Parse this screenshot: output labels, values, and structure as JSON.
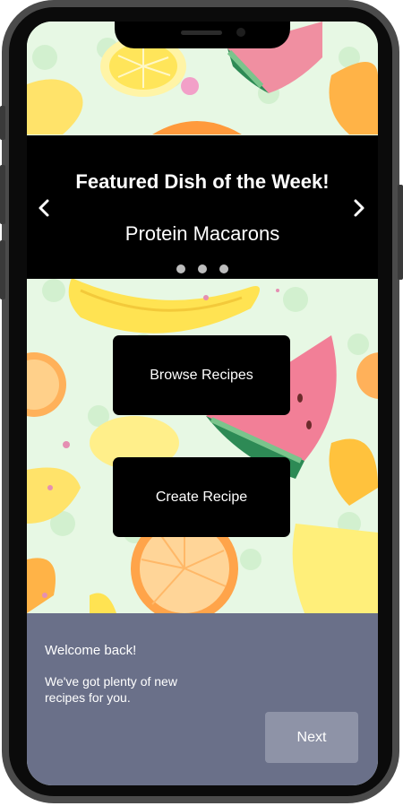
{
  "featured": {
    "title": "Featured Dish of the Week!",
    "dish": "Protein Macarons",
    "prev_icon": "chevron-left-icon",
    "next_icon": "chevron-right-icon",
    "carousel_dot_count": 3
  },
  "actions": {
    "browse_label": "Browse Recipes",
    "create_label": "Create Recipe"
  },
  "welcome": {
    "title": "Welcome back!",
    "message": "We've got plenty of new recipes for you.",
    "next_label": "Next"
  },
  "colors": {
    "background": "#e7f8e4",
    "banner": "#000000",
    "panel": "#6a7089",
    "next_button": "#8e93a7"
  }
}
